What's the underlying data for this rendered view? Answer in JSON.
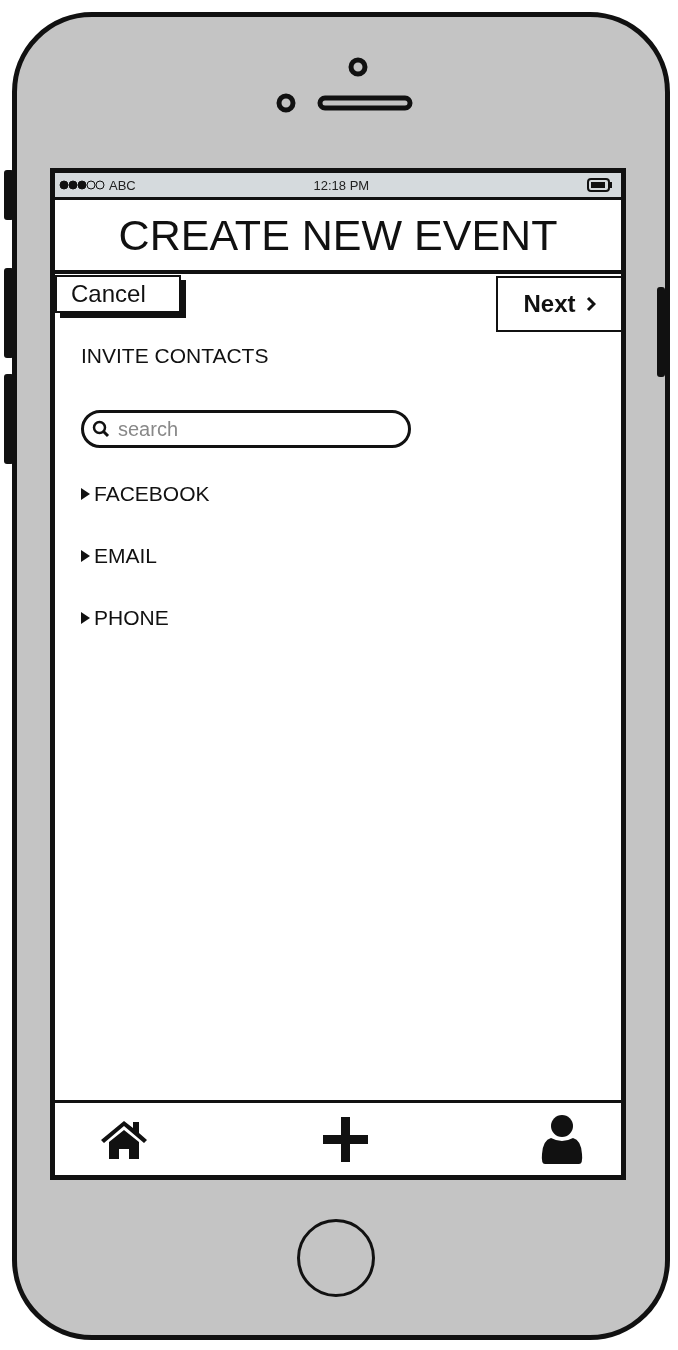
{
  "status_bar": {
    "carrier": "ABC",
    "time": "12:18 PM"
  },
  "title": "CREATE NEW EVENT",
  "nav": {
    "cancel": "Cancel",
    "next": "Next"
  },
  "section_title": "INVITE CONTACTS",
  "search": {
    "placeholder": "search"
  },
  "groups": [
    {
      "label": "FACEBOOK",
      "expanded": false
    },
    {
      "label": "EMAIL",
      "expanded": false
    },
    {
      "label": "PHONE",
      "expanded": false
    }
  ],
  "tab_bar": [
    {
      "kind": "home"
    },
    {
      "kind": "add"
    },
    {
      "kind": "profile"
    }
  ]
}
